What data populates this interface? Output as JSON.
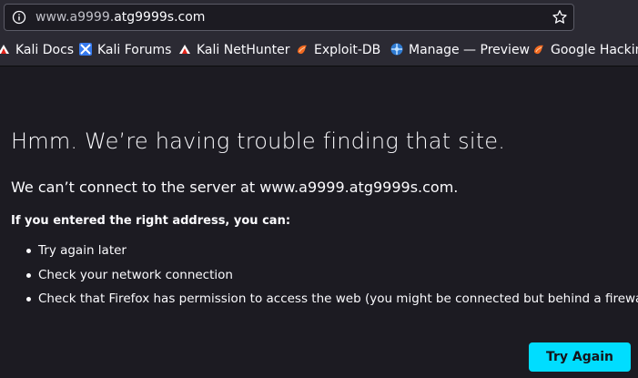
{
  "urlbar": {
    "prefix": "www.a9999.",
    "host": "atg9999s.com"
  },
  "bookmarks": [
    {
      "label": "Kali Docs",
      "icon": "kali-dragon-icon"
    },
    {
      "label": "Kali Forums",
      "icon": "kali-forums-icon"
    },
    {
      "label": "Kali NetHunter",
      "icon": "kali-dragon-icon"
    },
    {
      "label": "Exploit-DB",
      "icon": "exploit-db-icon"
    },
    {
      "label": "Manage — Preview",
      "icon": "globe-icon"
    },
    {
      "label": "Google Hacking",
      "icon": "exploit-db-icon"
    }
  ],
  "error": {
    "title": "Hmm. We’re having trouble finding that site.",
    "lead": "We can’t connect to the server at www.a9999.atg9999s.com.",
    "subheading": "If you entered the right address, you can:",
    "tips": [
      "Try again later",
      "Check your network connection",
      "Check that Firefox has permission to access the web (you might be connected but behind a firewall)"
    ],
    "button_label": "Try Again"
  },
  "colors": {
    "background": "#1c1b22",
    "toolbar": "#2b2a33",
    "accent": "#00ddff"
  }
}
